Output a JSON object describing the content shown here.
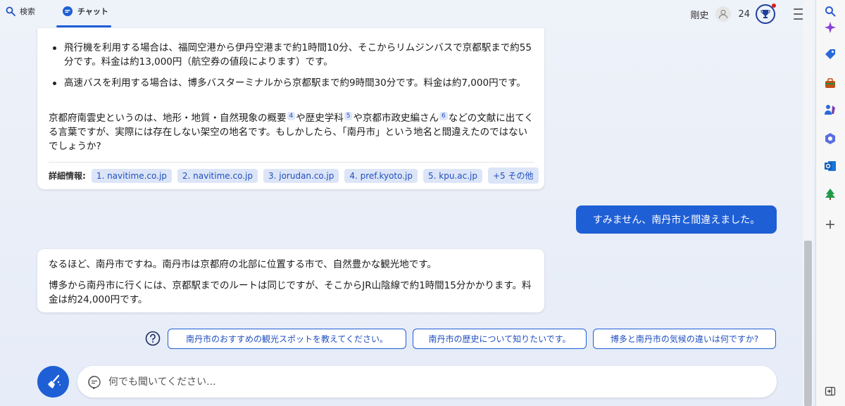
{
  "tabs": {
    "search": "検索",
    "chat": "チャット"
  },
  "user": {
    "name": "剛史",
    "points": "24"
  },
  "card1": {
    "bullet1": "飛行機を利用する場合は、福岡空港から伊丹空港まで約1時間10分、そこからリムジンバスで京都駅まで約55分です。料金は約13,000円（航空券の値段によります）です。",
    "bullet2": "高速バスを利用する場合は、博多バスターミナルから京都駅まで約9時間30分です。料金は約7,000円です。",
    "p_part1": "京都府南雲史というのは、地形・地質・自然現象の概要",
    "sup4": "4",
    "p_part2": "や歴史学科",
    "sup5": "5",
    "p_part3": "や京都市政史編さん",
    "sup6": "6",
    "p_part4": "などの文献に出てくる言葉ですが、実際には存在しない架空の地名です。もしかしたら、「南丹市」という地名と間違えたのではないでしょうか?",
    "refs_label": "詳細情報:",
    "refs": [
      "1. navitime.co.jp",
      "2. navitime.co.jp",
      "3. jorudan.co.jp",
      "4. pref.kyoto.jp",
      "5. kpu.ac.jp",
      "+5 その他"
    ]
  },
  "user_message": "すみません、南丹市と間違えました。",
  "card2": {
    "p1": "なるほど、南丹市ですね。南丹市は京都府の北部に位置する市で、自然豊かな観光地です。",
    "p2": "博多から南丹市に行くには、京都駅までのルートは同じですが、そこからJR山陰線で約1時間15分かかります。料金は約24,000円です。"
  },
  "suggestions": [
    "南丹市のおすすめの観光スポットを教えてください。",
    "南丹市の歴史について知りたいです。",
    "博多と南丹市の気候の違いは何ですか?"
  ],
  "input": {
    "placeholder": "何でも聞いてください..."
  },
  "colors": {
    "accent": "#1f5fd6",
    "chip_bg": "#dce5f7"
  }
}
